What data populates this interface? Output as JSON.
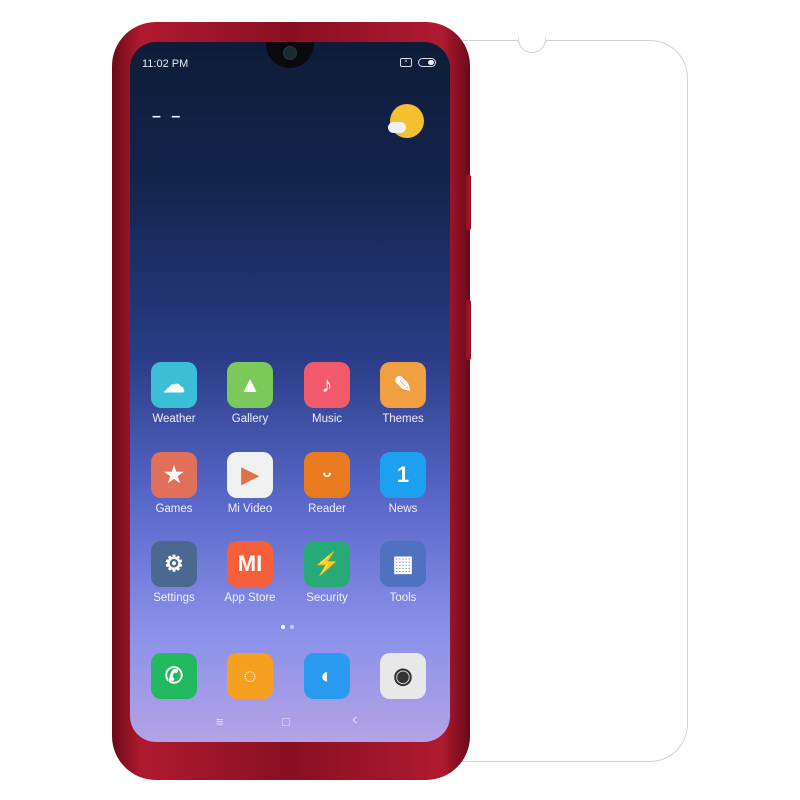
{
  "status_bar": {
    "time": "11:02 PM",
    "sim_icon": "sim-icon",
    "battery_icon": "battery-icon"
  },
  "clock_widget": {
    "placeholder": "– –"
  },
  "weather_widget": {
    "icon": "sun-cloud-icon"
  },
  "apps": [
    {
      "label": "Weather",
      "icon": "weather-icon",
      "color": "#3bbfd8"
    },
    {
      "label": "Gallery",
      "icon": "gallery-icon",
      "color": "#7cc85a"
    },
    {
      "label": "Music",
      "icon": "music-icon",
      "color": "#f05a6a"
    },
    {
      "label": "Themes",
      "icon": "themes-icon",
      "color": "#f0a040"
    },
    {
      "label": "Games",
      "icon": "games-icon",
      "color": "#e0705a"
    },
    {
      "label": "Mi Video",
      "icon": "mi-video-icon",
      "color": "#f0f0f0"
    },
    {
      "label": "Reader",
      "icon": "reader-icon",
      "color": "#ea7a20"
    },
    {
      "label": "News",
      "icon": "news-icon",
      "color": "#1ea0f0"
    },
    {
      "label": "Settings",
      "icon": "settings-icon",
      "color": "#4a6890"
    },
    {
      "label": "App Store",
      "icon": "app-store-icon",
      "color": "#f5603a"
    },
    {
      "label": "Security",
      "icon": "security-icon",
      "color": "#28aa78"
    },
    {
      "label": "Tools",
      "icon": "tools-folder-icon",
      "color": "#5070c0"
    }
  ],
  "dock": [
    {
      "icon": "phone-icon",
      "color": "#22b860"
    },
    {
      "icon": "messaging-icon",
      "color": "#f5a020"
    },
    {
      "icon": "browser-icon",
      "color": "#2a9af0"
    },
    {
      "icon": "camera-icon",
      "color": "#e8e8e8"
    }
  ],
  "pager": {
    "pages": 2,
    "current": 1
  },
  "nav_bar": {
    "menu": "≡",
    "home": "□",
    "back": "‹"
  }
}
